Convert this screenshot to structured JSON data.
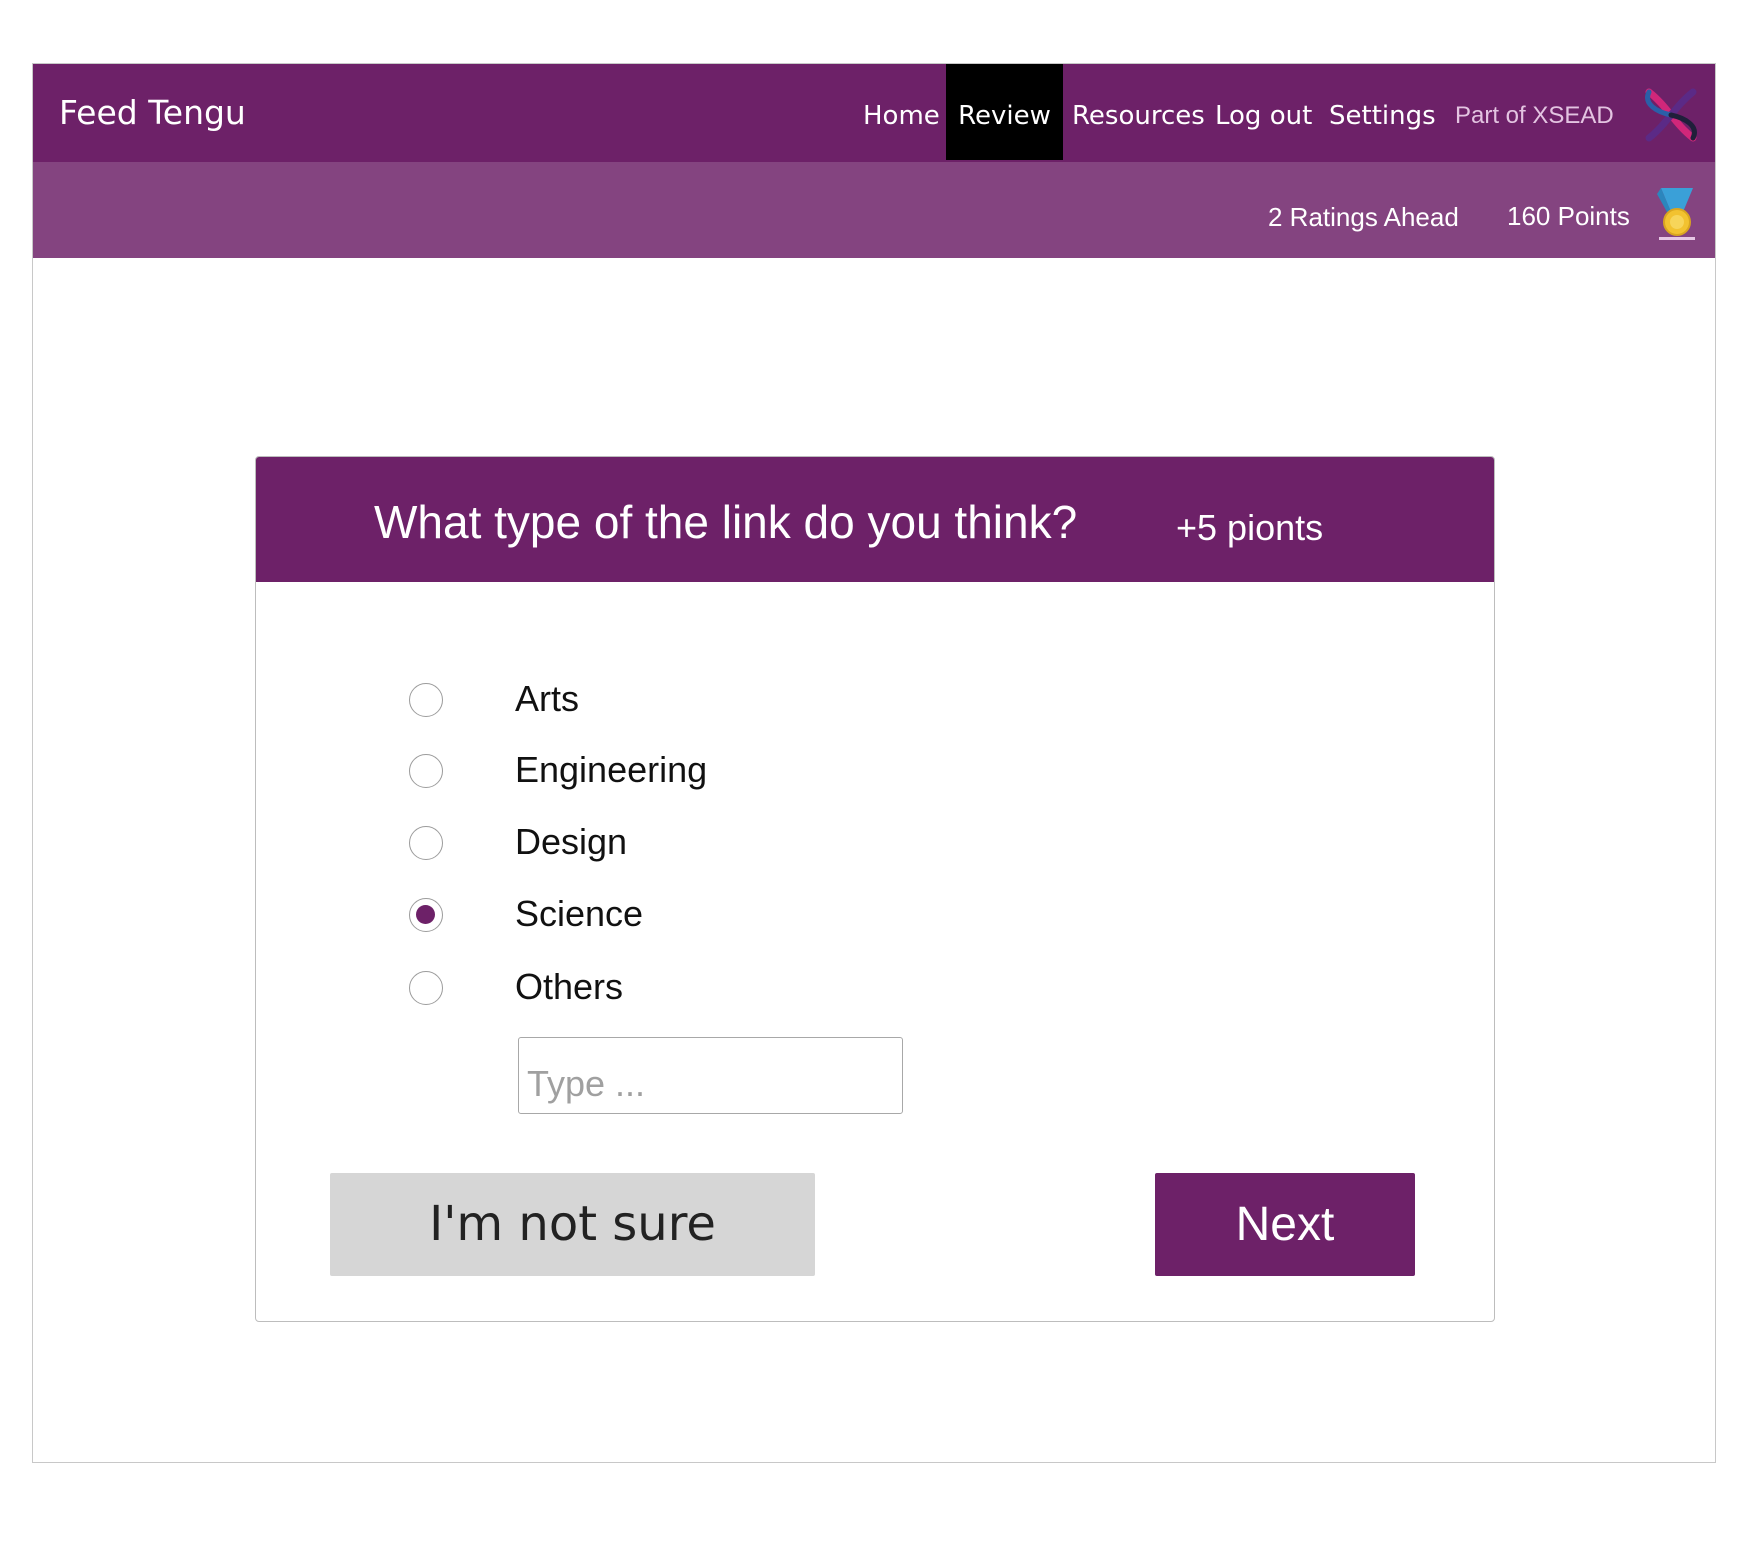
{
  "app": {
    "title": "Feed Tengu"
  },
  "nav": {
    "items": [
      {
        "label": "Home",
        "active": false
      },
      {
        "label": "Review",
        "active": true
      },
      {
        "label": "Resources",
        "active": false
      },
      {
        "label": "Log out",
        "active": false
      },
      {
        "label": "Settings",
        "active": false
      }
    ],
    "part_of": "Part of XSEAD",
    "logo_icon": "xsead-logo-icon"
  },
  "status": {
    "ratings_ahead": "2 Ratings Ahead",
    "points": "160 Points",
    "medal_icon": "medal-icon"
  },
  "question": {
    "text": "What type of the link do you think?",
    "reward": "+5 pionts",
    "options": [
      {
        "label": "Arts",
        "selected": false
      },
      {
        "label": "Engineering",
        "selected": false
      },
      {
        "label": "Design",
        "selected": false
      },
      {
        "label": "Science",
        "selected": true
      },
      {
        "label": "Others",
        "selected": false
      }
    ],
    "other_input": {
      "value": "",
      "placeholder": "Type ..."
    }
  },
  "actions": {
    "unsure_label": "I'm not sure",
    "next_label": "Next"
  },
  "colors": {
    "primary": "#6d2168",
    "secondary_bar": "#844480",
    "active_nav": "#000000",
    "unsure_button": "#d6d6d6"
  }
}
